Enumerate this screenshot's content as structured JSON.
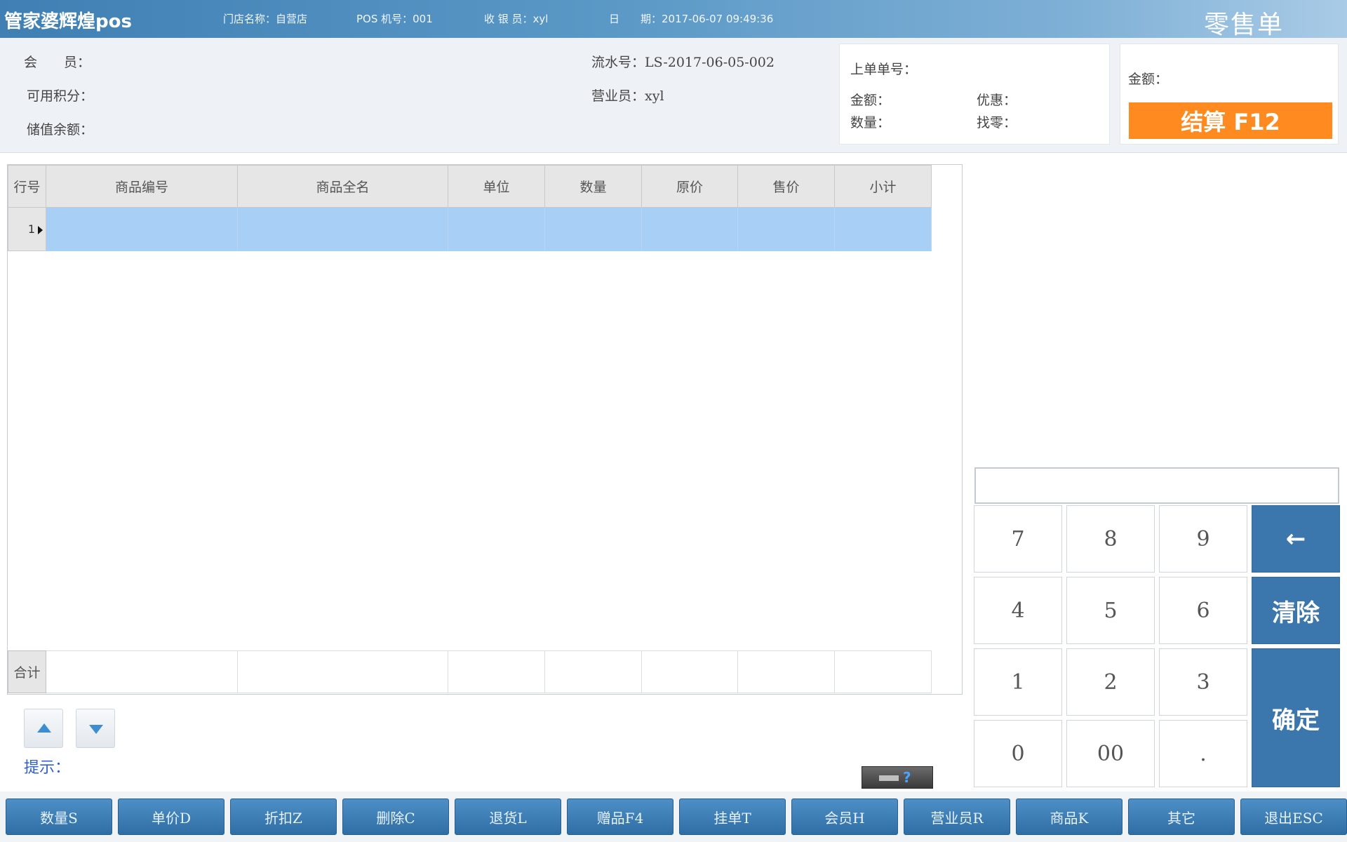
{
  "titlebar": {
    "app_name": "管家婆辉煌pos",
    "store": "门店名称：自营店",
    "pos_no": "POS 机号：001",
    "cashier": "收 银 员：xyl",
    "date": "日　　期：2017-06-07 09:49:36",
    "form_title": "零售单"
  },
  "header": {
    "member_label": "会　　员：",
    "points_label": "可用积分：",
    "stored_balance_label": "储值余额：",
    "serial_label": "流水号：LS-2017-06-05-002",
    "salesperson_label": "营业员：xyl",
    "last_order_label": "上单单号：",
    "last_amount_label": "金额：",
    "last_discount_label": "优惠：",
    "last_qty_label": "数量：",
    "last_change_label": "找零：",
    "amount_label": "金额：",
    "settle_label": "结算 F12"
  },
  "grid": {
    "columns": [
      "行号",
      "商品编号",
      "商品全名",
      "单位",
      "数量",
      "原价",
      "售价",
      "小计"
    ],
    "rows": [
      {
        "row_no": "1"
      }
    ],
    "total_label": "合计"
  },
  "hint_label": "提示：",
  "tray_help": "?",
  "input": {
    "value": ""
  },
  "keypad": {
    "k7": "7",
    "k8": "8",
    "k9": "9",
    "back": "←",
    "k4": "4",
    "k5": "5",
    "k6": "6",
    "clear": "清除",
    "k1": "1",
    "k2": "2",
    "k3": "3",
    "confirm": "确定",
    "k0": "0",
    "k00": "00",
    "dot": "."
  },
  "bottom": [
    "数量S",
    "单价D",
    "折扣Z",
    "删除C",
    "退货L",
    "赠品F4",
    "挂单T",
    "会员H",
    "营业员R",
    "商品K",
    "其它",
    "退出ESC"
  ]
}
